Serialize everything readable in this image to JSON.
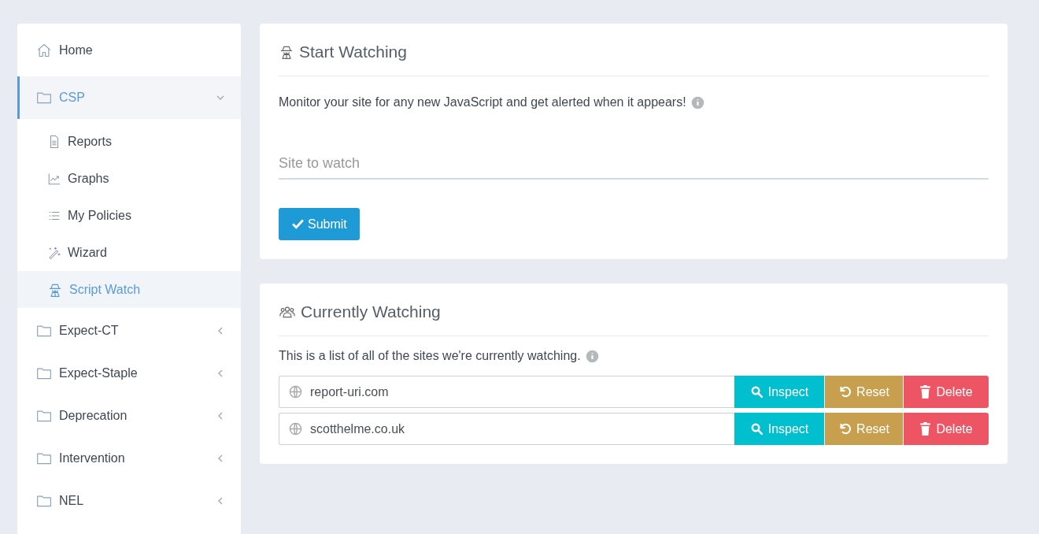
{
  "sidebar": {
    "items": [
      {
        "kind": "link",
        "label": "Home",
        "selected": false
      },
      {
        "kind": "group",
        "label": "CSP",
        "expanded": true,
        "selected": true,
        "children": [
          {
            "label": "Reports",
            "selected": false
          },
          {
            "label": "Graphs",
            "selected": false
          },
          {
            "label": "My Policies",
            "selected": false
          },
          {
            "label": "Wizard",
            "selected": false
          },
          {
            "label": "Script Watch",
            "selected": true
          }
        ]
      },
      {
        "kind": "group",
        "label": "Expect-CT",
        "expanded": false,
        "selected": false
      },
      {
        "kind": "group",
        "label": "Expect-Staple",
        "expanded": false,
        "selected": false
      },
      {
        "kind": "group",
        "label": "Deprecation",
        "expanded": false,
        "selected": false
      },
      {
        "kind": "group",
        "label": "Intervention",
        "expanded": false,
        "selected": false
      },
      {
        "kind": "group",
        "label": "NEL",
        "expanded": false,
        "selected": false
      }
    ]
  },
  "start_watching": {
    "title": "Start Watching",
    "description": "Monitor your site for any new JavaScript and get alerted when it appears!",
    "site_field": {
      "placeholder": "Site to watch"
    },
    "submit": "Submit"
  },
  "currently_watching": {
    "title": "Currently Watching",
    "description": "This is a list of all of the sites we're currently watching.",
    "sites": [
      {
        "site": "report-uri.com",
        "actions": [
          {
            "kind": "inspect",
            "label": "Inspect"
          },
          {
            "kind": "reset",
            "label": "Reset"
          },
          {
            "kind": "delete",
            "label": "Delete"
          }
        ]
      },
      {
        "site": "scotthelme.co.uk",
        "actions": [
          {
            "kind": "inspect",
            "label": "Inspect"
          },
          {
            "kind": "reset",
            "label": "Reset"
          },
          {
            "kind": "delete",
            "label": "Delete"
          }
        ]
      }
    ]
  }
}
